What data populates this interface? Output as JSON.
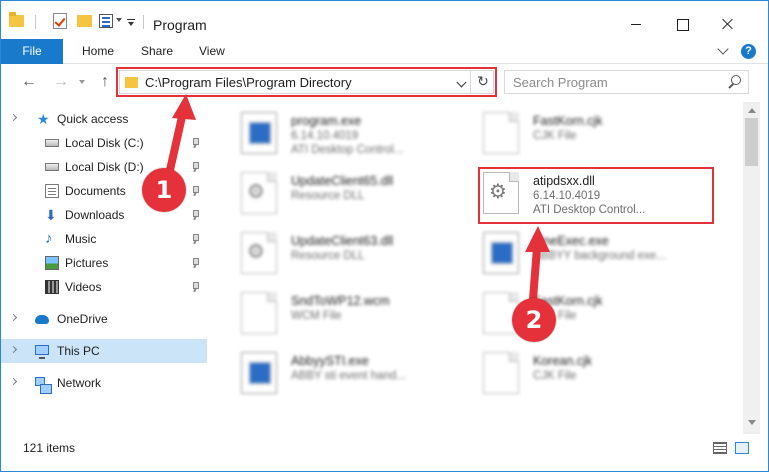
{
  "window": {
    "title": "Program"
  },
  "ribbon": {
    "file": "File",
    "home": "Home",
    "share": "Share",
    "view": "View",
    "help": "?"
  },
  "address": {
    "path": "C:\\Program Files\\Program Directory"
  },
  "search": {
    "placeholder": "Search Program"
  },
  "sidebar": {
    "items": [
      {
        "label": "Quick access"
      },
      {
        "label": "Local Disk (C:)"
      },
      {
        "label": "Local Disk (D:)"
      },
      {
        "label": "Documents"
      },
      {
        "label": "Downloads"
      },
      {
        "label": "Music"
      },
      {
        "label": "Pictures"
      },
      {
        "label": "Videos"
      },
      {
        "label": "OneDrive"
      },
      {
        "label": "This PC"
      },
      {
        "label": "Network"
      }
    ]
  },
  "files": [
    {
      "name": "program.exe",
      "line2": "6.14.10.4019",
      "line3": "ATI Desktop Control..."
    },
    {
      "name": "FastKorn.cjk",
      "line2": "CJK File",
      "line3": ""
    },
    {
      "name": "UpdateClient65.dll",
      "line2": "Resource DLL",
      "line3": ""
    },
    {
      "name": "atipdsxx.dll",
      "line2": "6.14.10.4019",
      "line3": "ATI Desktop Control..."
    },
    {
      "name": "UpdateClient63.dll",
      "line2": "Resource DLL",
      "line3": ""
    },
    {
      "name": "FineExec.exe",
      "line2": "ABBYY background exe...",
      "line3": ""
    },
    {
      "name": "SndToWP12.wcm",
      "line2": "WCM File",
      "line3": ""
    },
    {
      "name": "FastKorn.cjk",
      "line2": "CJK File",
      "line3": ""
    },
    {
      "name": "AbbyySTI.exe",
      "line2": "ABBY sti event hand...",
      "line3": ""
    },
    {
      "name": "Korean.cjk",
      "line2": "CJK File",
      "line3": ""
    }
  ],
  "status": {
    "items": "121 items"
  },
  "annotations": {
    "step1": "1",
    "step2": "2",
    "color": "#e5323a"
  }
}
